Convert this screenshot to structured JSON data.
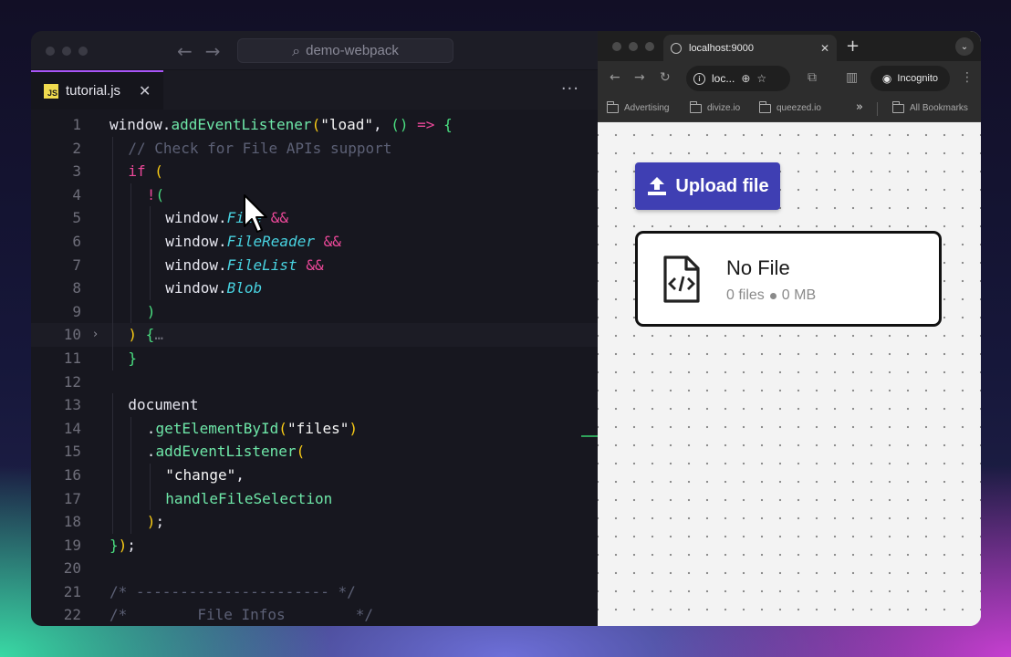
{
  "editor": {
    "command_center": "demo-webpack",
    "tab": {
      "icon": "JS",
      "name": "tutorial.js"
    },
    "lines": [
      {
        "n": "1",
        "indent": 0,
        "tokens": [
          [
            "plain",
            "window."
          ],
          [
            "fn",
            "addEventListener"
          ],
          [
            "br1",
            "("
          ],
          [
            "str",
            "\"load\""
          ],
          [
            "plain",
            ", "
          ],
          [
            "br2",
            "()"
          ],
          [
            "op",
            " => "
          ],
          [
            "br2",
            "{"
          ]
        ]
      },
      {
        "n": "2",
        "indent": 1,
        "tokens": [
          [
            "cmt",
            "// Check for File APIs support"
          ]
        ]
      },
      {
        "n": "3",
        "indent": 1,
        "tokens": [
          [
            "kw",
            "if "
          ],
          [
            "br1",
            "("
          ]
        ]
      },
      {
        "n": "4",
        "indent": 2,
        "tokens": [
          [
            "op",
            "!"
          ],
          [
            "br2",
            "("
          ]
        ]
      },
      {
        "n": "5",
        "indent": 3,
        "tokens": [
          [
            "plain",
            "window."
          ],
          [
            "prop",
            "File"
          ],
          [
            "op",
            " &&"
          ]
        ]
      },
      {
        "n": "6",
        "indent": 3,
        "tokens": [
          [
            "plain",
            "window."
          ],
          [
            "prop",
            "FileReader"
          ],
          [
            "op",
            " &&"
          ]
        ]
      },
      {
        "n": "7",
        "indent": 3,
        "tokens": [
          [
            "plain",
            "window."
          ],
          [
            "prop",
            "FileList"
          ],
          [
            "op",
            " &&"
          ]
        ]
      },
      {
        "n": "8",
        "indent": 3,
        "tokens": [
          [
            "plain",
            "window."
          ],
          [
            "prop",
            "Blob"
          ]
        ]
      },
      {
        "n": "9",
        "indent": 2,
        "tokens": [
          [
            "br2",
            ")"
          ]
        ]
      },
      {
        "n": "10",
        "indent": 1,
        "fold": "›",
        "active": true,
        "tokens": [
          [
            "br1",
            ")"
          ],
          [
            "plain",
            " "
          ],
          [
            "br2",
            "{"
          ],
          [
            "fold",
            "…"
          ]
        ]
      },
      {
        "n": "11",
        "indent": 1,
        "tokens": [
          [
            "br2",
            "}"
          ]
        ]
      },
      {
        "n": "12",
        "indent": 0,
        "tokens": []
      },
      {
        "n": "13",
        "indent": 1,
        "tokens": [
          [
            "plain",
            "document"
          ]
        ]
      },
      {
        "n": "14",
        "indent": 2,
        "tokens": [
          [
            "plain",
            "."
          ],
          [
            "fn",
            "getElementById"
          ],
          [
            "br1",
            "("
          ],
          [
            "str",
            "\"files\""
          ],
          [
            "br1",
            ")"
          ]
        ]
      },
      {
        "n": "15",
        "indent": 2,
        "tokens": [
          [
            "plain",
            "."
          ],
          [
            "fn",
            "addEventListener"
          ],
          [
            "br1",
            "("
          ]
        ]
      },
      {
        "n": "16",
        "indent": 3,
        "tokens": [
          [
            "str",
            "\"change\""
          ],
          [
            "plain",
            ","
          ]
        ]
      },
      {
        "n": "17",
        "indent": 3,
        "tokens": [
          [
            "fn",
            "handleFileSelection"
          ]
        ]
      },
      {
        "n": "18",
        "indent": 2,
        "tokens": [
          [
            "br1",
            ")"
          ],
          [
            "plain",
            ";"
          ]
        ]
      },
      {
        "n": "19",
        "indent": 0,
        "tokens": [
          [
            "br2",
            "}"
          ],
          [
            "br1",
            ")"
          ],
          [
            "plain",
            ";"
          ]
        ]
      },
      {
        "n": "20",
        "indent": 0,
        "tokens": []
      },
      {
        "n": "21",
        "indent": 0,
        "tokens": [
          [
            "cmt",
            "/* ---------------------- */"
          ]
        ]
      },
      {
        "n": "22",
        "indent": 0,
        "tokens": [
          [
            "cmt",
            "/*        File Infos        */"
          ]
        ]
      }
    ]
  },
  "browser": {
    "tab_title": "localhost:9000",
    "address": "loc...",
    "incognito_label": "Incognito",
    "bookmarks": [
      "Advertising",
      "divize.io",
      "queezed.io"
    ],
    "all_bookmarks": "All Bookmarks",
    "page": {
      "upload_label": "Upload file",
      "card_title": "No File",
      "files_count": "0 files",
      "size": "0 MB",
      "accent": "#3f3fb3"
    }
  }
}
